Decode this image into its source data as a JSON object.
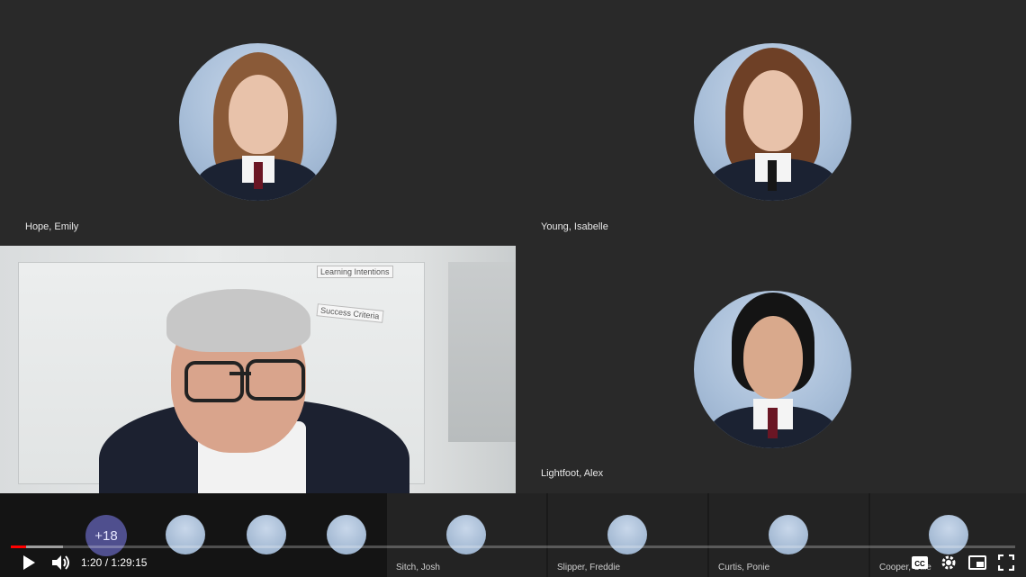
{
  "participants": {
    "top_left": {
      "name": "Hope, Emily"
    },
    "top_right": {
      "name": "Young, Isabelle"
    },
    "mid_right": {
      "name": "Lightfoot, Alex"
    }
  },
  "speaker_video": {
    "sign_1": "Learning Intentions",
    "sign_2": "Success Criteria"
  },
  "filmstrip": {
    "more_count": "+18",
    "names": [
      "Sitch, Josh",
      "Slipper, Freddie",
      "Curtis, Ponie",
      "Cooper, Ollie"
    ]
  },
  "player": {
    "current_time": "1:20",
    "separator": " / ",
    "duration": "1:29:15",
    "progress_fraction": 0.015,
    "buffered_fraction": 0.052,
    "accent": "#ff0000",
    "icons": [
      "play-icon",
      "volume-icon",
      "cc-icon",
      "settings-icon",
      "miniplayer-icon",
      "fullscreen-icon"
    ]
  },
  "colors": {
    "background": "#1f1f1f",
    "tile": "#292929",
    "more_badge": "#4f4f8e"
  }
}
